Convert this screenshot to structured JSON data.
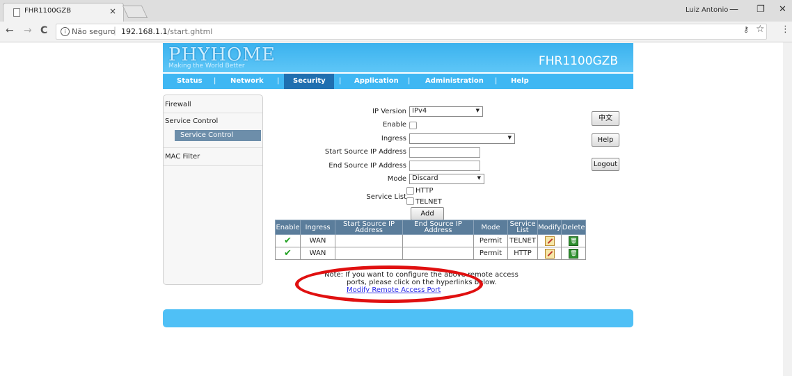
{
  "browser": {
    "tab_title": "FHR1100GZB",
    "tab_close": "×",
    "user_name": "Luiz Antonio",
    "minimize": "—",
    "maximize": "❐",
    "close": "✕",
    "back": "←",
    "forward": "→",
    "reload": "C",
    "not_secure": "Não seguro",
    "url_host": "192.168.1.1",
    "url_path": "/start.ghtml",
    "key_icon": "⚷",
    "star_icon": "☆",
    "menu_icon": "⋮"
  },
  "banner": {
    "logo": "PHYHOME",
    "tagline": "Making the World Better",
    "model": "FHR1100GZB"
  },
  "menu": {
    "items": [
      "Status",
      "Network",
      "Security",
      "Application",
      "Administration",
      "Help"
    ],
    "separator": "|",
    "active": "Security"
  },
  "sidebar": {
    "firewall": "Firewall",
    "service_control": "Service Control",
    "service_control_sub": "Service Control",
    "mac_filter": "MAC Filter"
  },
  "form": {
    "ip_version_label": "IP Version",
    "ip_version_value": "IPv4",
    "enable_label": "Enable",
    "ingress_label": "Ingress",
    "ingress_value": "",
    "start_ip_label": "Start Source IP Address",
    "end_ip_label": "End Source IP Address",
    "mode_label": "Mode",
    "mode_value": "Discard",
    "service_list_label": "Service List",
    "service_http": "HTTP",
    "service_telnet": "TELNET",
    "add_button": "Add",
    "arrow": "▼"
  },
  "side_buttons": {
    "lang": "中文",
    "help": "Help",
    "logout": "Logout"
  },
  "table": {
    "headers": [
      "Enable",
      "Ingress",
      "Start Source IP Address",
      "End Source IP Address",
      "Mode",
      "Service List",
      "Modify",
      "Delete"
    ],
    "rows": [
      {
        "enable": "✔",
        "ingress": "WAN",
        "start": "",
        "end": "",
        "mode": "Permit",
        "service": "TELNET"
      },
      {
        "enable": "✔",
        "ingress": "WAN",
        "start": "",
        "end": "",
        "mode": "Permit",
        "service": "HTTP"
      }
    ]
  },
  "note": {
    "line1": "Note: If you want to configure the above remote access",
    "line2": "ports, please click on the hyperlinks below.",
    "link": "Modify Remote Access Port"
  },
  "colors": {
    "banner": "#3bb2ee",
    "menu": "#3fb7f3",
    "active_menu": "#1f6fb0",
    "table_header": "#5b7d9b",
    "highlight": "#e01010"
  }
}
